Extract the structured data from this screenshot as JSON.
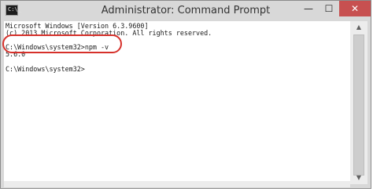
{
  "window": {
    "title": "Administrator: Command Prompt",
    "icon_label": "C:\\_",
    "minimize_glyph": "—",
    "maximize_glyph": "☐",
    "close_glyph": "✕"
  },
  "console": {
    "lines": [
      "Microsoft Windows [Version 6.3.9600]",
      "(c) 2013 Microsoft Corporation. All rights reserved.",
      "",
      "C:\\Windows\\system32>npm -v",
      "5.6.0",
      "",
      "C:\\Windows\\system32>"
    ]
  },
  "scrollbar": {
    "up_glyph": "▲",
    "down_glyph": "▼"
  },
  "colors": {
    "highlight": "#d6302a",
    "close_button": "#c75050"
  }
}
